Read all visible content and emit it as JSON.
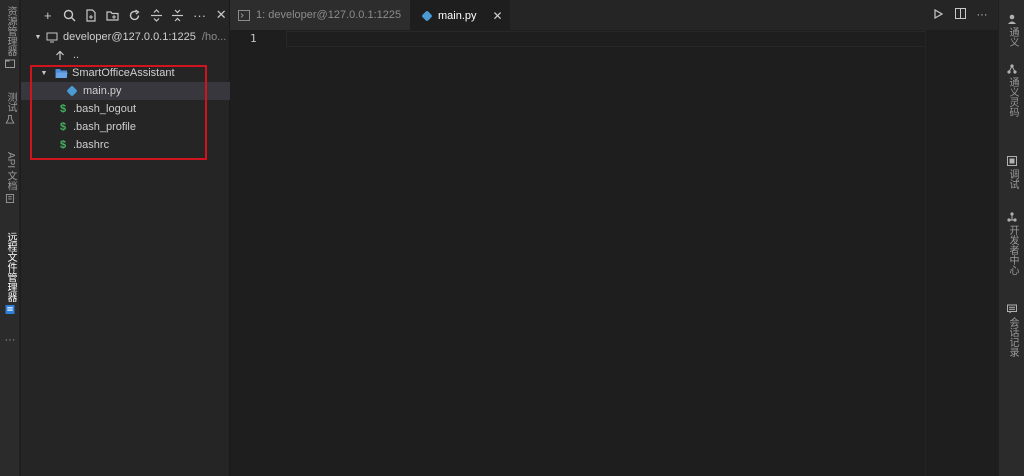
{
  "left_activity": {
    "items": [
      {
        "label": "资源管理器",
        "icon": "file-explorer-icon"
      },
      {
        "label": "测试",
        "icon": "flask-icon"
      },
      {
        "label": "API 文档",
        "icon": "book-icon"
      },
      {
        "label": "远程文件管理器",
        "icon": "remote-explorer-icon"
      }
    ],
    "more": "···"
  },
  "sidebar": {
    "toolbar": {
      "new": "+",
      "search": "search-icon",
      "new_file": "new-file-icon",
      "new_folder": "new-folder-icon",
      "refresh": "refresh-icon",
      "expand": "expand-icon",
      "collapse": "collapse-icon",
      "more": "···",
      "close": "✕"
    },
    "tree": {
      "root_label": "developer@127.0.0.1:1225",
      "root_path": "/ho...",
      "up_label": "..",
      "folder": "SmartOfficeAssistant",
      "file_main": "main.py",
      "file_bash_logout": ".bash_logout",
      "file_bash_profile": ".bash_profile",
      "file_bashrc": ".bashrc",
      "shell_glyph": "$"
    }
  },
  "tabs": {
    "terminal_label": "1: developer@127.0.0.1:1225",
    "main_label": "main.py",
    "close": "✕"
  },
  "editor": {
    "line_numbers": [
      "1"
    ]
  },
  "right_activity": {
    "items": [
      {
        "label": "通义",
        "icon": "tongyi-icon"
      },
      {
        "label": "通义灵码",
        "icon": "network-icon"
      },
      {
        "label": "调试",
        "icon": "debug-icon"
      },
      {
        "label": "开发者中心",
        "icon": "dev-center-icon"
      },
      {
        "label": "会话记录",
        "icon": "chat-icon"
      }
    ]
  },
  "colors": {
    "highlight_border": "#d0141e",
    "shell_green": "#43b35f",
    "python_blue": "#4a9ad4",
    "folder_blue": "#4c8bd6"
  }
}
